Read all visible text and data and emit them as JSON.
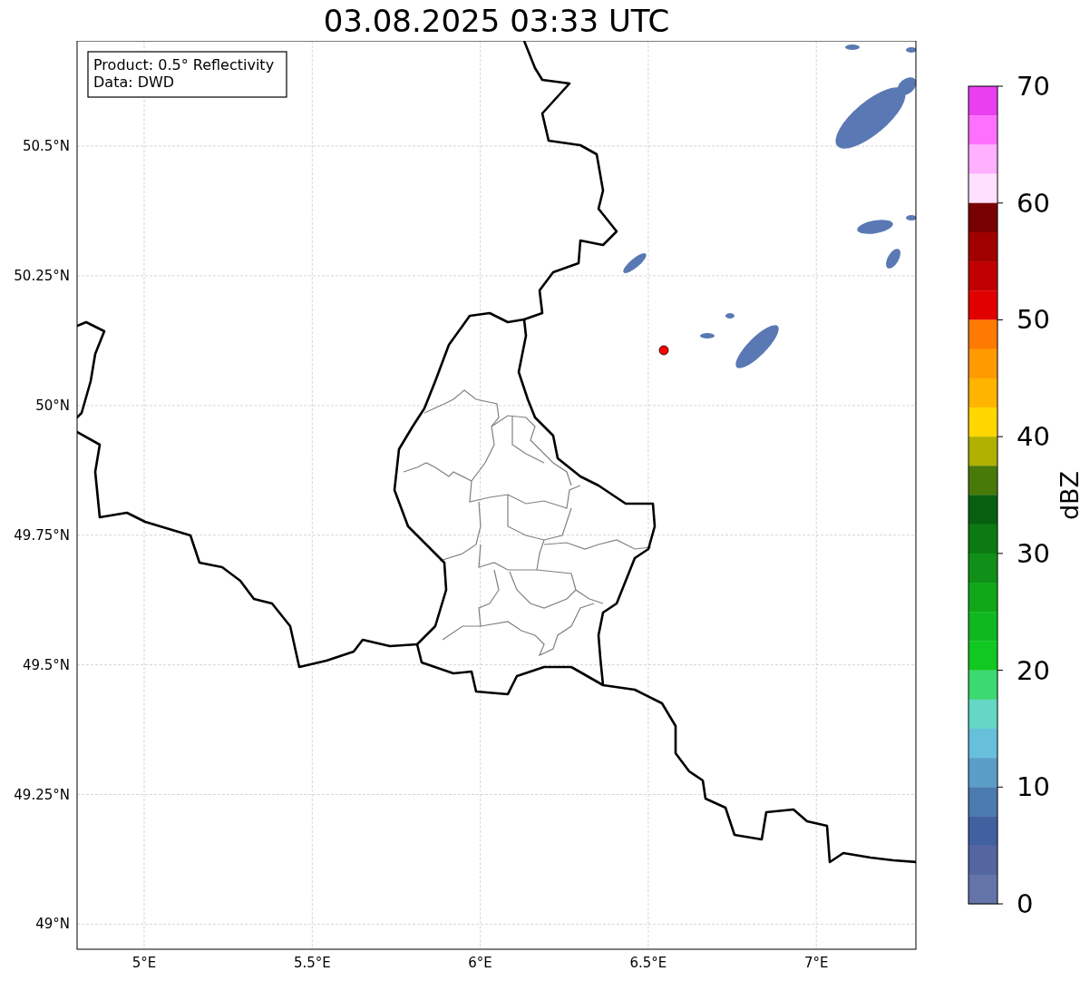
{
  "title": "03.08.2025 03:33 UTC",
  "legend_box": {
    "lines": [
      "Product: 0.5° Reflectivity",
      "Data: DWD"
    ]
  },
  "map": {
    "xticks": [
      "5°E",
      "5.5°E",
      "6°E",
      "6.5°E",
      "7°E"
    ],
    "yticks": [
      "50.5°N",
      "50.25°N",
      "50°N",
      "49.75°N",
      "49.5°N",
      "49.25°N",
      "49°N"
    ]
  },
  "colorbar": {
    "label": "dBZ",
    "ticks": [
      "70",
      "60",
      "50",
      "40",
      "30",
      "20",
      "10",
      "0"
    ],
    "segments": [
      {
        "color": "#e840f0"
      },
      {
        "color": "#ff70ff"
      },
      {
        "color": "#ffb0ff"
      },
      {
        "color": "#ffe0ff"
      },
      {
        "color": "#780000"
      },
      {
        "color": "#a00000"
      },
      {
        "color": "#c00000"
      },
      {
        "color": "#e00000"
      },
      {
        "color": "#ff7a00"
      },
      {
        "color": "#ff9a00"
      },
      {
        "color": "#ffb400"
      },
      {
        "color": "#ffd700"
      },
      {
        "color": "#b0b000"
      },
      {
        "color": "#487a0a"
      },
      {
        "color": "#066010"
      },
      {
        "color": "#0c7a12"
      },
      {
        "color": "#109018"
      },
      {
        "color": "#10a818"
      },
      {
        "color": "#10b820"
      },
      {
        "color": "#10c820"
      },
      {
        "color": "#3cd870"
      },
      {
        "color": "#64d8c4"
      },
      {
        "color": "#66c0dc"
      },
      {
        "color": "#5a9ec8"
      },
      {
        "color": "#4a7ab0"
      },
      {
        "color": "#4160a0"
      },
      {
        "color": "#5366a0"
      },
      {
        "color": "#6474a8"
      }
    ]
  }
}
